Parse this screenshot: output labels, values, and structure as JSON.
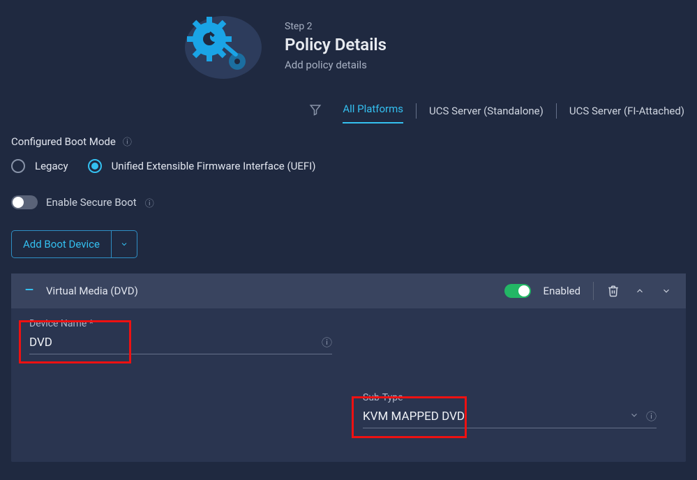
{
  "header": {
    "step": "Step 2",
    "title": "Policy Details",
    "subtitle": "Add policy details"
  },
  "tabs": {
    "items": [
      {
        "label": "All Platforms",
        "active": true
      },
      {
        "label": "UCS Server (Standalone)",
        "active": false
      },
      {
        "label": "UCS Server (FI-Attached)",
        "active": false
      }
    ]
  },
  "boot_mode": {
    "label": "Configured Boot Mode",
    "options": {
      "legacy": "Legacy",
      "uefi": "Unified Extensible Firmware Interface (UEFI)"
    },
    "selected": "uefi"
  },
  "secure_boot": {
    "label": "Enable Secure Boot",
    "enabled": false
  },
  "add_btn": {
    "label": "Add Boot Device"
  },
  "device": {
    "title": "Virtual Media (DVD)",
    "enabled_label": "Enabled",
    "enabled": true,
    "fields": {
      "name_label": "Device Name *",
      "name_value": "DVD",
      "subtype_label": "Sub-Type",
      "subtype_value": "KVM MAPPED DVD"
    }
  }
}
